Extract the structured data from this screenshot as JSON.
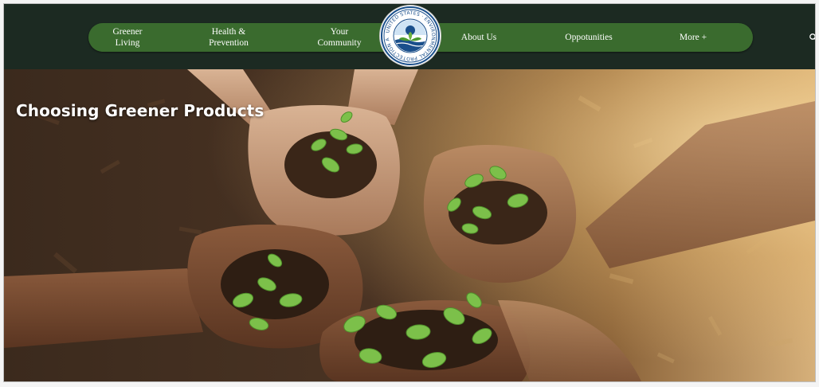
{
  "nav": {
    "items": [
      {
        "label": "Greener\nLiving"
      },
      {
        "label": "Health &\nPrevention"
      },
      {
        "label": "Your\nCommunity"
      },
      {
        "label": "About Us"
      },
      {
        "label": "Oppotunities"
      },
      {
        "label": "More +"
      }
    ],
    "search_icon": "search-icon"
  },
  "logo": {
    "ring_text": "UNITED STATES · ENVIRONMENTAL PROTECTION AGENCY",
    "icon": "epa-seal-icon"
  },
  "hero": {
    "title": "Choosing Greener Products",
    "image": "hands-holding-seedlings-photo"
  },
  "colors": {
    "topbar": "#1c2a22",
    "nav": "#3a6b2e",
    "title": "#ffffff"
  }
}
